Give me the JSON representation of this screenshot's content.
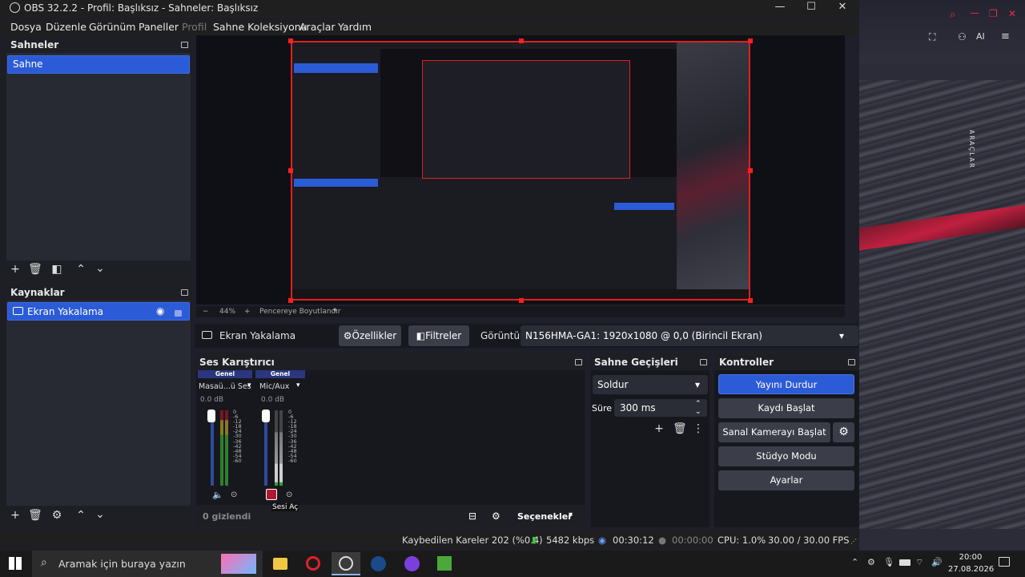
{
  "window": {
    "title": "OBS 32.2.2 - Profil: Başlıksız - Sahneler: Başlıksız",
    "minimize": "—",
    "maximize": "☐",
    "close": "✕"
  },
  "menu": [
    "Dosya",
    "Düzenle",
    "Görünüm",
    "Paneller",
    "Profil",
    "Sahne Koleksiyonu",
    "Araçlar",
    "Yardım"
  ],
  "scenes": {
    "title": "Sahneler",
    "items": [
      "Sahne"
    ]
  },
  "sources": {
    "title": "Kaynaklar",
    "items": [
      {
        "label": "Ekran Yakalama"
      }
    ]
  },
  "preview": {
    "zoom": "44%",
    "zoom_minus": "−",
    "zoom_plus": "+",
    "fit_label": "Pencereye Boyutlandır"
  },
  "source_bar": {
    "source": "Ekran Yakalama",
    "properties": "Özellikler",
    "filters": "Filtreler",
    "display_label": "Görüntü",
    "display_value": "N156HMA-GA1: 1920x1080 @ 0,0 (Birincil Ekran)"
  },
  "mixer": {
    "title": "Ses Karıştırıcı",
    "channels": [
      {
        "tag": "Genel",
        "name": "Masaü...ü Ses",
        "db": "0.0 dB"
      },
      {
        "tag": "Genel",
        "name": "Mic/Aux",
        "db": "0.0 dB"
      }
    ],
    "scale": [
      "0",
      "-6",
      "-12",
      "-18",
      "-24",
      "-30",
      "-36",
      "-42",
      "-48",
      "-54",
      "-60"
    ],
    "hidden": "0 gizlendi",
    "tooltip": "Sesi Aç",
    "options": "Seçenekler"
  },
  "transitions": {
    "title": "Sahne Geçişleri",
    "type": "Soldur",
    "duration_label": "Süre",
    "duration": "300 ms"
  },
  "controls": {
    "title": "Kontroller",
    "stop_stream": "Yayını Durdur",
    "start_record": "Kaydı Başlat",
    "virtual_cam": "Sanal Kamerayı Başlat",
    "studio_mode": "Stüdyo Modu",
    "settings": "Ayarlar"
  },
  "status": {
    "dropped": "Kaybedilen Kareler 202 (%0.4)",
    "bitrate": "5482 kbps",
    "stream_time": "00:30:12",
    "record_time": "00:00:00",
    "cpu": "CPU: 1.0%",
    "fps": "30.00 / 30.00 FPS"
  },
  "taskbar": {
    "search": "Aramak için buraya yazın",
    "time": "20:00",
    "date": "27.08.2026"
  },
  "right_panel": {
    "ai_label": "AI",
    "vertical_label": "ARAÇLAR"
  },
  "colors": {
    "accent": "#2b5bd6",
    "selection_border": "#e02020"
  }
}
